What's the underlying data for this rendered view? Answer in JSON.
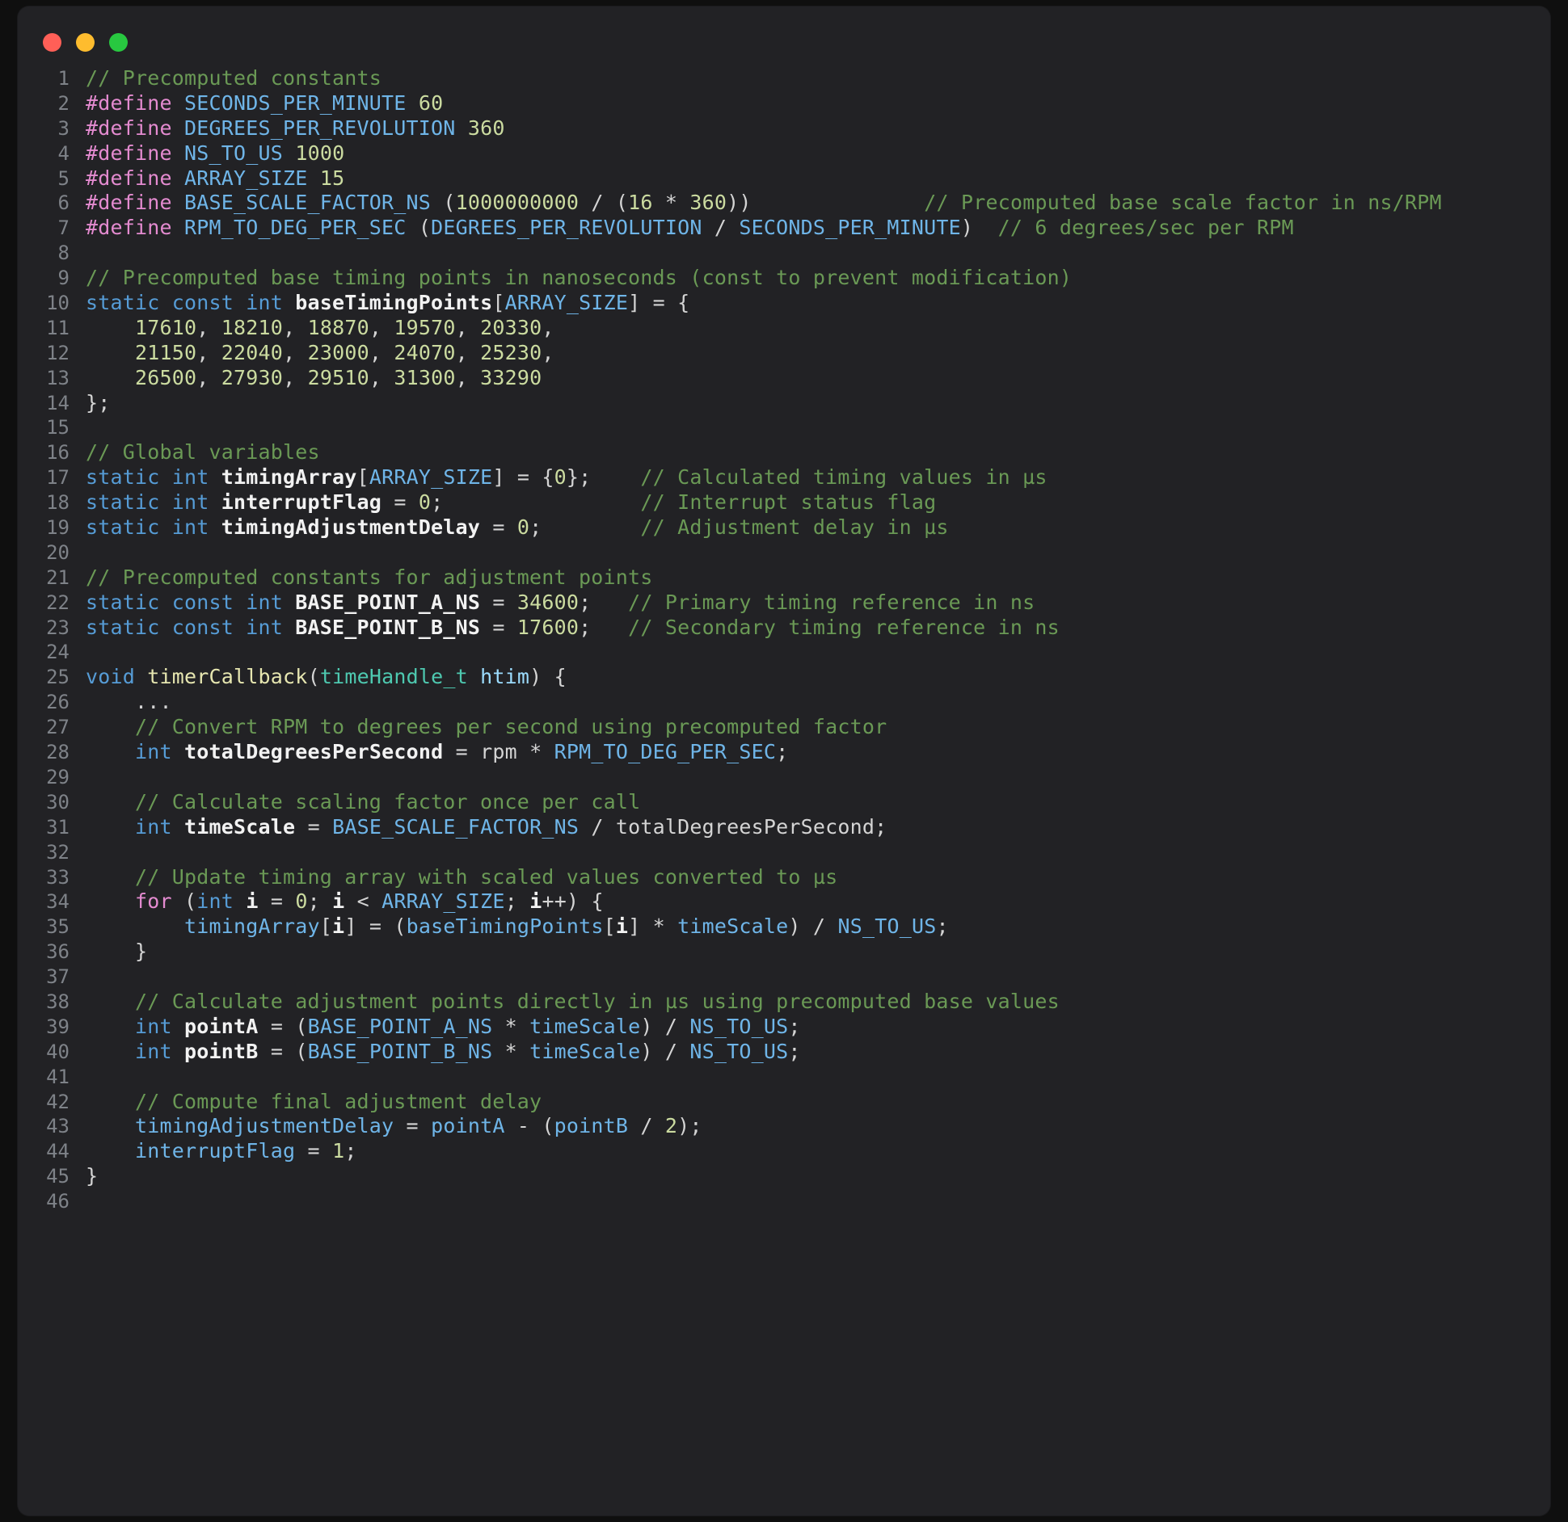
{
  "window": {
    "title_bar": {
      "traffic_lights": [
        {
          "name": "close",
          "color": "#ff5f57"
        },
        {
          "name": "minimize",
          "color": "#febc2e"
        },
        {
          "name": "maximize",
          "color": "#28c840"
        }
      ]
    },
    "background": "#222225"
  },
  "editor": {
    "language": "c",
    "first_line": 1,
    "last_line": 46,
    "theme": {
      "background": "#222225",
      "line_number": "#7e8288",
      "comment": "#6a9955",
      "preprocessor": "#e48bd0",
      "type_keyword": "#569cd6",
      "identifier": "#6fb5e8",
      "number": "#cbdba0",
      "punctuation": "#d4d4d4",
      "declaration": "#f2f2f2",
      "function": "#e6e6b0",
      "typename": "#4ec9b0",
      "parameter": "#9cdcfe"
    },
    "line_numbers": [
      "1",
      "2",
      "3",
      "4",
      "5",
      "6",
      "7",
      "8",
      "9",
      "10",
      "11",
      "12",
      "13",
      "14",
      "15",
      "16",
      "17",
      "18",
      "19",
      "20",
      "21",
      "22",
      "23",
      "24",
      "25",
      "26",
      "27",
      "28",
      "29",
      "30",
      "31",
      "32",
      "33",
      "34",
      "35",
      "36",
      "37",
      "38",
      "39",
      "40",
      "41",
      "42",
      "43",
      "44",
      "45",
      "46"
    ],
    "lines": [
      "// Precomputed constants",
      "#define SECONDS_PER_MINUTE 60",
      "#define DEGREES_PER_REVOLUTION 360",
      "#define NS_TO_US 1000",
      "#define ARRAY_SIZE 15",
      "#define BASE_SCALE_FACTOR_NS (1000000000 / (16 * 360))              // Precomputed base scale factor in ns/RPM",
      "#define RPM_TO_DEG_PER_SEC (DEGREES_PER_REVOLUTION / SECONDS_PER_MINUTE)  // 6 degrees/sec per RPM",
      "",
      "// Precomputed base timing points in nanoseconds (const to prevent modification)",
      "static const int baseTimingPoints[ARRAY_SIZE] = {",
      "    17610, 18210, 18870, 19570, 20330,",
      "    21150, 22040, 23000, 24070, 25230,",
      "    26500, 27930, 29510, 31300, 33290",
      "};",
      "",
      "// Global variables",
      "static int timingArray[ARRAY_SIZE] = {0};    // Calculated timing values in µs",
      "static int interruptFlag = 0;                // Interrupt status flag",
      "static int timingAdjustmentDelay = 0;        // Adjustment delay in µs",
      "",
      "// Precomputed constants for adjustment points",
      "static const int BASE_POINT_A_NS = 34600;   // Primary timing reference in ns",
      "static const int BASE_POINT_B_NS = 17600;   // Secondary timing reference in ns",
      "",
      "void timerCallback(timeHandle_t htim) {",
      "    ...",
      "    // Convert RPM to degrees per second using precomputed factor",
      "    int totalDegreesPerSecond = rpm * RPM_TO_DEG_PER_SEC;",
      "",
      "    // Calculate scaling factor once per call",
      "    int timeScale = BASE_SCALE_FACTOR_NS / totalDegreesPerSecond;",
      "",
      "    // Update timing array with scaled values converted to µs",
      "    for (int i = 0; i < ARRAY_SIZE; i++) {",
      "        timingArray[i] = (baseTimingPoints[i] * timeScale) / NS_TO_US;",
      "    }",
      "",
      "    // Calculate adjustment points directly in µs using precomputed base values",
      "    int pointA = (BASE_POINT_A_NS * timeScale) / NS_TO_US;",
      "    int pointB = (BASE_POINT_B_NS * timeScale) / NS_TO_US;",
      "",
      "    // Compute final adjustment delay",
      "    timingAdjustmentDelay = pointA - (pointB / 2);",
      "    interruptFlag = 1;",
      "}",
      ""
    ],
    "tokens": [
      [
        [
          "c",
          "// Precomputed constants"
        ]
      ],
      [
        [
          "kw",
          "#define"
        ],
        [
          "pl",
          " "
        ],
        [
          "id",
          "SECONDS_PER_MINUTE"
        ],
        [
          "pl",
          " "
        ],
        [
          "num",
          "60"
        ]
      ],
      [
        [
          "kw",
          "#define"
        ],
        [
          "pl",
          " "
        ],
        [
          "id",
          "DEGREES_PER_REVOLUTION"
        ],
        [
          "pl",
          " "
        ],
        [
          "num",
          "360"
        ]
      ],
      [
        [
          "kw",
          "#define"
        ],
        [
          "pl",
          " "
        ],
        [
          "id",
          "NS_TO_US"
        ],
        [
          "pl",
          " "
        ],
        [
          "num",
          "1000"
        ]
      ],
      [
        [
          "kw",
          "#define"
        ],
        [
          "pl",
          " "
        ],
        [
          "id",
          "ARRAY_SIZE"
        ],
        [
          "pl",
          " "
        ],
        [
          "num",
          "15"
        ]
      ],
      [
        [
          "kw",
          "#define"
        ],
        [
          "pl",
          " "
        ],
        [
          "id",
          "BASE_SCALE_FACTOR_NS"
        ],
        [
          "pl",
          " ("
        ],
        [
          "num",
          "1000000000"
        ],
        [
          "pl",
          " / ("
        ],
        [
          "num",
          "16"
        ],
        [
          "pl",
          " * "
        ],
        [
          "num",
          "360"
        ],
        [
          "pl",
          "))"
        ],
        [
          "pl",
          "              "
        ],
        [
          "c",
          "// Precomputed base scale factor in ns/RPM"
        ]
      ],
      [
        [
          "kw",
          "#define"
        ],
        [
          "pl",
          " "
        ],
        [
          "id",
          "RPM_TO_DEG_PER_SEC"
        ],
        [
          "pl",
          " ("
        ],
        [
          "id",
          "DEGREES_PER_REVOLUTION"
        ],
        [
          "pl",
          " / "
        ],
        [
          "id",
          "SECONDS_PER_MINUTE"
        ],
        [
          "pl",
          ")  "
        ],
        [
          "c",
          "// 6 degrees/sec per RPM"
        ]
      ],
      [],
      [
        [
          "c",
          "// Precomputed base timing points in nanoseconds (const to prevent modification)"
        ]
      ],
      [
        [
          "ty",
          "static const int"
        ],
        [
          "pl",
          " "
        ],
        [
          "de",
          "baseTimingPoints"
        ],
        [
          "pl",
          "["
        ],
        [
          "id",
          "ARRAY_SIZE"
        ],
        [
          "pl",
          "] = {"
        ]
      ],
      [
        [
          "pl",
          "    "
        ],
        [
          "num",
          "17610"
        ],
        [
          "pl",
          ", "
        ],
        [
          "num",
          "18210"
        ],
        [
          "pl",
          ", "
        ],
        [
          "num",
          "18870"
        ],
        [
          "pl",
          ", "
        ],
        [
          "num",
          "19570"
        ],
        [
          "pl",
          ", "
        ],
        [
          "num",
          "20330"
        ],
        [
          "pl",
          ","
        ]
      ],
      [
        [
          "pl",
          "    "
        ],
        [
          "num",
          "21150"
        ],
        [
          "pl",
          ", "
        ],
        [
          "num",
          "22040"
        ],
        [
          "pl",
          ", "
        ],
        [
          "num",
          "23000"
        ],
        [
          "pl",
          ", "
        ],
        [
          "num",
          "24070"
        ],
        [
          "pl",
          ", "
        ],
        [
          "num",
          "25230"
        ],
        [
          "pl",
          ","
        ]
      ],
      [
        [
          "pl",
          "    "
        ],
        [
          "num",
          "26500"
        ],
        [
          "pl",
          ", "
        ],
        [
          "num",
          "27930"
        ],
        [
          "pl",
          ", "
        ],
        [
          "num",
          "29510"
        ],
        [
          "pl",
          ", "
        ],
        [
          "num",
          "31300"
        ],
        [
          "pl",
          ", "
        ],
        [
          "num",
          "33290"
        ]
      ],
      [
        [
          "pl",
          "};"
        ]
      ],
      [],
      [
        [
          "c",
          "// Global variables"
        ]
      ],
      [
        [
          "ty",
          "static int"
        ],
        [
          "pl",
          " "
        ],
        [
          "de",
          "timingArray"
        ],
        [
          "pl",
          "["
        ],
        [
          "id",
          "ARRAY_SIZE"
        ],
        [
          "pl",
          "] = {"
        ],
        [
          "num",
          "0"
        ],
        [
          "pl",
          "};"
        ],
        [
          "pl",
          "    "
        ],
        [
          "c",
          "// Calculated timing values in µs"
        ]
      ],
      [
        [
          "ty",
          "static int"
        ],
        [
          "pl",
          " "
        ],
        [
          "de",
          "interruptFlag"
        ],
        [
          "pl",
          " = "
        ],
        [
          "num",
          "0"
        ],
        [
          "pl",
          ";"
        ],
        [
          "pl",
          "                "
        ],
        [
          "c",
          "// Interrupt status flag"
        ]
      ],
      [
        [
          "ty",
          "static int"
        ],
        [
          "pl",
          " "
        ],
        [
          "de",
          "timingAdjustmentDelay"
        ],
        [
          "pl",
          " = "
        ],
        [
          "num",
          "0"
        ],
        [
          "pl",
          ";"
        ],
        [
          "pl",
          "        "
        ],
        [
          "c",
          "// Adjustment delay in µs"
        ]
      ],
      [],
      [
        [
          "c",
          "// Precomputed constants for adjustment points"
        ]
      ],
      [
        [
          "ty",
          "static const int"
        ],
        [
          "pl",
          " "
        ],
        [
          "de",
          "BASE_POINT_A_NS"
        ],
        [
          "pl",
          " = "
        ],
        [
          "num",
          "34600"
        ],
        [
          "pl",
          ";"
        ],
        [
          "pl",
          "   "
        ],
        [
          "c",
          "// Primary timing reference in ns"
        ]
      ],
      [
        [
          "ty",
          "static const int"
        ],
        [
          "pl",
          " "
        ],
        [
          "de",
          "BASE_POINT_B_NS"
        ],
        [
          "pl",
          " = "
        ],
        [
          "num",
          "17600"
        ],
        [
          "pl",
          ";"
        ],
        [
          "pl",
          "   "
        ],
        [
          "c",
          "// Secondary timing reference in ns"
        ]
      ],
      [],
      [
        [
          "ty",
          "void"
        ],
        [
          "pl",
          " "
        ],
        [
          "fn",
          "timerCallback"
        ],
        [
          "pl",
          "("
        ],
        [
          "tn",
          "timeHandle_t"
        ],
        [
          "pl",
          " "
        ],
        [
          "pm",
          "htim"
        ],
        [
          "pl",
          ") {"
        ]
      ],
      [
        [
          "pl",
          "    ..."
        ]
      ],
      [
        [
          "pl",
          "    "
        ],
        [
          "c",
          "// Convert RPM to degrees per second using precomputed factor"
        ]
      ],
      [
        [
          "pl",
          "    "
        ],
        [
          "ty",
          "int"
        ],
        [
          "pl",
          " "
        ],
        [
          "de",
          "totalDegreesPerSecond"
        ],
        [
          "pl",
          " = "
        ],
        [
          "pl",
          "rpm"
        ],
        [
          "pl",
          " * "
        ],
        [
          "id",
          "RPM_TO_DEG_PER_SEC"
        ],
        [
          "pl",
          ";"
        ]
      ],
      [],
      [
        [
          "pl",
          "    "
        ],
        [
          "c",
          "// Calculate scaling factor once per call"
        ]
      ],
      [
        [
          "pl",
          "    "
        ],
        [
          "ty",
          "int"
        ],
        [
          "pl",
          " "
        ],
        [
          "de",
          "timeScale"
        ],
        [
          "pl",
          " = "
        ],
        [
          "id",
          "BASE_SCALE_FACTOR_NS"
        ],
        [
          "pl",
          " / "
        ],
        [
          "pl",
          "totalDegreesPerSecond"
        ],
        [
          "pl",
          ";"
        ]
      ],
      [],
      [
        [
          "pl",
          "    "
        ],
        [
          "c",
          "// Update timing array with scaled values converted to µs"
        ]
      ],
      [
        [
          "pl",
          "    "
        ],
        [
          "kw",
          "for"
        ],
        [
          "pl",
          " ("
        ],
        [
          "ty",
          "int"
        ],
        [
          "pl",
          " "
        ],
        [
          "de",
          "i"
        ],
        [
          "pl",
          " = "
        ],
        [
          "num",
          "0"
        ],
        [
          "pl",
          "; "
        ],
        [
          "de",
          "i"
        ],
        [
          "pl",
          " < "
        ],
        [
          "id",
          "ARRAY_SIZE"
        ],
        [
          "pl",
          "; "
        ],
        [
          "de",
          "i"
        ],
        [
          "pl",
          "++) {"
        ]
      ],
      [
        [
          "pl",
          "        "
        ],
        [
          "id",
          "timingArray"
        ],
        [
          "pl",
          "["
        ],
        [
          "de",
          "i"
        ],
        [
          "pl",
          "] = ("
        ],
        [
          "id",
          "baseTimingPoints"
        ],
        [
          "pl",
          "["
        ],
        [
          "de",
          "i"
        ],
        [
          "pl",
          "] * "
        ],
        [
          "id",
          "timeScale"
        ],
        [
          "pl",
          ") / "
        ],
        [
          "id",
          "NS_TO_US"
        ],
        [
          "pl",
          ";"
        ]
      ],
      [
        [
          "pl",
          "    }"
        ]
      ],
      [],
      [
        [
          "pl",
          "    "
        ],
        [
          "c",
          "// Calculate adjustment points directly in µs using precomputed base values"
        ]
      ],
      [
        [
          "pl",
          "    "
        ],
        [
          "ty",
          "int"
        ],
        [
          "pl",
          " "
        ],
        [
          "de",
          "pointA"
        ],
        [
          "pl",
          " = ("
        ],
        [
          "id",
          "BASE_POINT_A_NS"
        ],
        [
          "pl",
          " * "
        ],
        [
          "id",
          "timeScale"
        ],
        [
          "pl",
          ") / "
        ],
        [
          "id",
          "NS_TO_US"
        ],
        [
          "pl",
          ";"
        ]
      ],
      [
        [
          "pl",
          "    "
        ],
        [
          "ty",
          "int"
        ],
        [
          "pl",
          " "
        ],
        [
          "de",
          "pointB"
        ],
        [
          "pl",
          " = ("
        ],
        [
          "id",
          "BASE_POINT_B_NS"
        ],
        [
          "pl",
          " * "
        ],
        [
          "id",
          "timeScale"
        ],
        [
          "pl",
          ") / "
        ],
        [
          "id",
          "NS_TO_US"
        ],
        [
          "pl",
          ";"
        ]
      ],
      [],
      [
        [
          "pl",
          "    "
        ],
        [
          "c",
          "// Compute final adjustment delay"
        ]
      ],
      [
        [
          "pl",
          "    "
        ],
        [
          "id",
          "timingAdjustmentDelay"
        ],
        [
          "pl",
          " = "
        ],
        [
          "id",
          "pointA"
        ],
        [
          "pl",
          " - ("
        ],
        [
          "id",
          "pointB"
        ],
        [
          "pl",
          " / "
        ],
        [
          "num",
          "2"
        ],
        [
          "pl",
          ");"
        ]
      ],
      [
        [
          "pl",
          "    "
        ],
        [
          "id",
          "interruptFlag"
        ],
        [
          "pl",
          " = "
        ],
        [
          "num",
          "1"
        ],
        [
          "pl",
          ";"
        ]
      ],
      [
        [
          "pl",
          "}"
        ]
      ],
      []
    ]
  }
}
